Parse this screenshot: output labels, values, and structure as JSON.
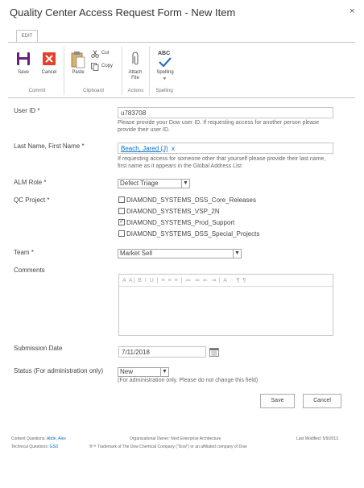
{
  "dialog": {
    "title": "Quality Center Access Request Form - New Item",
    "close_glyph": "×"
  },
  "ribbon": {
    "tab_label": "EDIT",
    "buttons": {
      "save": "Save",
      "cancel": "Cancel",
      "paste": "Paste",
      "cut": "Cut",
      "copy": "Copy",
      "attach_file": "Attach File",
      "spelling": "Spelling",
      "spelling_abc": "ABC"
    },
    "groups": {
      "commit": "Commit",
      "clipboard": "Clipboard",
      "actions": "Actions",
      "spelling": "Spelling"
    }
  },
  "form": {
    "user_id": {
      "label": "User ID *",
      "value": "u783708",
      "hint": "Please provide your Dow user ID. If requesting access for another person please provide their user ID."
    },
    "name": {
      "label": "Last Name, First Name *",
      "value": "Beach, Jared (J)",
      "remove_glyph": "x",
      "hint": "If requesting access for someone other that yourself please provide their last name, first name as it appears in the Global Address List"
    },
    "alm_role": {
      "label": "ALM Role *",
      "value": "Defect Triage"
    },
    "qc_project": {
      "label": "QC Project *",
      "options": [
        {
          "label": "DIAMOND_SYSTEMS_DSS_Core_Releases",
          "checked": false
        },
        {
          "label": "DIAMOND_SYSTEMS_VSP_2N",
          "checked": false
        },
        {
          "label": "DIAMOND_SYSTEMS_Prod_Support",
          "checked": true
        },
        {
          "label": "DIAMOND_SYSTEMS_DSS_Special_Projects",
          "checked": false
        }
      ]
    },
    "team": {
      "label": "Team *",
      "value": "Market Sell"
    },
    "comments": {
      "label": "Comments",
      "toolbar_glyphs": "A A| B I U | ≡ ≡ ≡ | ≔ ≔ ⇤ ⇥ | A ◌ ¶ ¶"
    },
    "submission_date": {
      "label": "Submission Date",
      "value": "7/11/2018"
    },
    "status": {
      "label": "Status (For administration only)",
      "value": "New",
      "hint": "(For administration only. Please do not change this field)"
    },
    "save_label": "Save",
    "cancel_label": "Cancel"
  },
  "footer": {
    "content_questions_label": "Content Questions:",
    "content_questions_contact": "Abde, Alex",
    "technical_questions_label": "Technical Questions:",
    "technical_questions_contact": "GSD",
    "owner": "Organizational Owner: Next Enterprise Architecture",
    "last_modified": "Last Modified: 5/9/2013",
    "trademark": "®™ Trademark of The Dow Chemical Company (\"Dow\") or an affiliated company of Dow"
  },
  "colors": {
    "accent_blue": "#0072c6",
    "save_purple": "#68217a",
    "cancel_red": "#e4412a"
  }
}
